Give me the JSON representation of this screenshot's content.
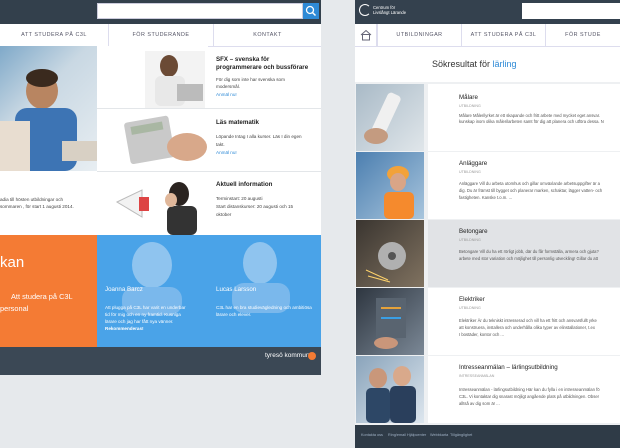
{
  "left_screen": {
    "nav": [
      "ATT STUDERA PÅ C3L",
      "FÖR STUDERANDE",
      "KONTAKT"
    ],
    "hero_text": [
      "adia till hösten utbildningar och",
      "sommaren , för start 1 augusti 2014."
    ],
    "tiles": [
      {
        "title": "SFX – svenska för",
        "title2": "programmerare och bussförare",
        "text": "För dig som inte har svenska som",
        "text2": "modersmål.",
        "link": "Anmäl nu!"
      },
      {
        "title": "Läs matematik",
        "text": "Löpande Intag I alla kurser. Läs I din egen",
        "text2": "takt.",
        "link": "Anmäl nu!"
      },
      {
        "title": "Aktuell information",
        "text": "Terminstart: 20 augusti",
        "text2": "Start distanskurser: 20 augusti och 15",
        "text3": "oktober"
      }
    ],
    "orange": {
      "heading": "kan",
      "line1": "Att studera på C3L",
      "line2": "personal"
    },
    "people": [
      {
        "name": "Joanna Barcz",
        "text": "Att plugga på C3L har varit en underbar",
        "text2": "tid för mig och en ny framtid. Kusniga",
        "text3": "lärare och jag har fått nya vänner.",
        "text4": "Rekommenderas!"
      },
      {
        "name": "Lucas Larsson",
        "text": "C3L har en bra studievägledning och ambitiösa",
        "text2": "lärare och elever."
      }
    ],
    "footer_logo": "tyresö kommun"
  },
  "right_screen": {
    "logo_line1": "Centrum för",
    "logo_line2": "Livslångt Lärande",
    "nav": [
      "UTBILDNINGAR",
      "ATT STUDERA PÅ C3L",
      "FÖR STUDE"
    ],
    "search_heading_prefix": "Sökresultat för",
    "search_term": "lärling",
    "results": [
      {
        "title": "Målare",
        "meta": "UTBILDNING",
        "desc": "Målare Målerilyrket är ett skapande och fritt arbete med mycket eget ansvar.",
        "desc2": "kunskap inom olika målerilarbeten samt för dig att planera och utföra dessa. N"
      },
      {
        "title": "Anläggare",
        "meta": "UTBILDNING",
        "desc": "Anläggare Vill du arbeta utomhus och gillar omväxlande arbetsuppgifter är a",
        "desc2": "dig. Du är främst till bygget och planerar marken, schaktar, lägger vatten- och",
        "desc3": "fastigheten. Kanske t.o.m. ..."
      },
      {
        "title": "Betongare",
        "meta": "UTBILDNING",
        "desc": "Betongare Vill du ha ett rörligt jobb, där du får formställa, armera och gjuta?",
        "desc2": "arbete med stor variation och möjlighet till personlig utveckling! Gillar du att"
      },
      {
        "title": "Elektriker",
        "meta": "UTBILDNING",
        "desc": "Elektriker Är du tekniskt intresserad och vill ha ett fritt och ansvarsfullt yrke",
        "desc2": "att konstruera, installera och underhålla olika typer av elinstallationer, t.ex",
        "desc3": "I bostäder, kontor och ..."
      },
      {
        "title": "Intresseanmälan – lärlingsutbildning",
        "meta": "INTRESSEANMÄLAN",
        "desc": "Intresseanmälan - lärlingsutbildning Här kan du fylla i en intresseanmälan fö",
        "desc2": "C3L. Vi kontaktar dig snarast möjligt angående plats på utbildningen. Obser",
        "desc3": "alltså av dig som är ..."
      }
    ],
    "footer_links": [
      "Kontakta oss",
      "Ring/email Hjälpcenter",
      "Webbkarta",
      "Tillgänglighet"
    ]
  },
  "colors": {
    "dark": "#33404c",
    "blue": "#2e8ad6",
    "orange": "#f47b34",
    "sky": "#4aa3e8"
  }
}
